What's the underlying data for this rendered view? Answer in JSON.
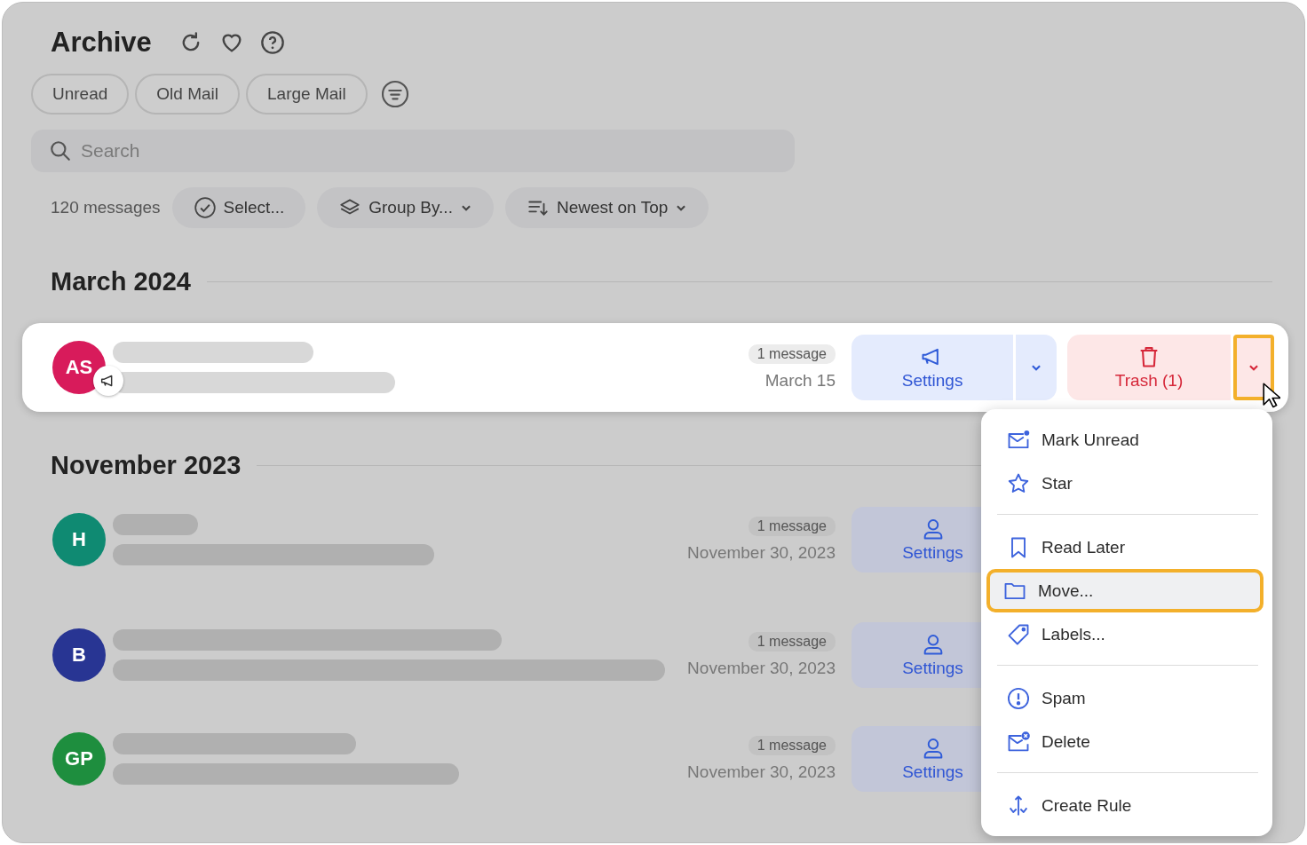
{
  "title": "Archive",
  "filters": [
    {
      "label": "Unread"
    },
    {
      "label": "Old Mail"
    },
    {
      "label": "Large Mail"
    }
  ],
  "search": {
    "placeholder": "Search"
  },
  "toolbar": {
    "count": "120 messages",
    "select": "Select...",
    "group_by": "Group By...",
    "sort": "Newest on Top"
  },
  "groups": [
    {
      "heading": "March 2024",
      "rows": [
        {
          "initials": "AS",
          "color": "#d81b5b",
          "kind": "announcement",
          "count": "1 message",
          "date": "March 15",
          "action": {
            "label": "Settings",
            "kind": "megaphone"
          },
          "trash": "Trash (1)",
          "selected": true,
          "menu_open": true
        }
      ]
    },
    {
      "heading": "November 2023",
      "rows": [
        {
          "initials": "H",
          "color": "#0f8a72",
          "count": "1 message",
          "date": "November 30, 2023",
          "action": {
            "label": "Settings",
            "kind": "person"
          },
          "selected": false
        },
        {
          "initials": "B",
          "color": "#283593",
          "count": "1 message",
          "date": "November 30, 2023",
          "action": {
            "label": "Settings",
            "kind": "person"
          },
          "selected": false
        },
        {
          "initials": "GP",
          "color": "#1e8e3e",
          "count": "1 message",
          "date": "November 30, 2023",
          "action": {
            "label": "Settings",
            "kind": "person"
          },
          "selected": false
        }
      ]
    }
  ],
  "menu": {
    "sections": [
      [
        {
          "label": "Mark Unread",
          "kind": "unread",
          "selected": false
        },
        {
          "label": "Star",
          "kind": "star",
          "selected": false
        }
      ],
      [
        {
          "label": "Read Later",
          "kind": "later",
          "selected": false
        },
        {
          "label": "Move...",
          "kind": "move",
          "selected": true
        },
        {
          "label": "Labels...",
          "kind": "label",
          "selected": false
        }
      ],
      [
        {
          "label": "Spam",
          "kind": "spam",
          "selected": false
        },
        {
          "label": "Delete",
          "kind": "delete",
          "selected": false
        }
      ],
      [
        {
          "label": "Create Rule",
          "kind": "rule",
          "selected": false
        }
      ]
    ]
  }
}
